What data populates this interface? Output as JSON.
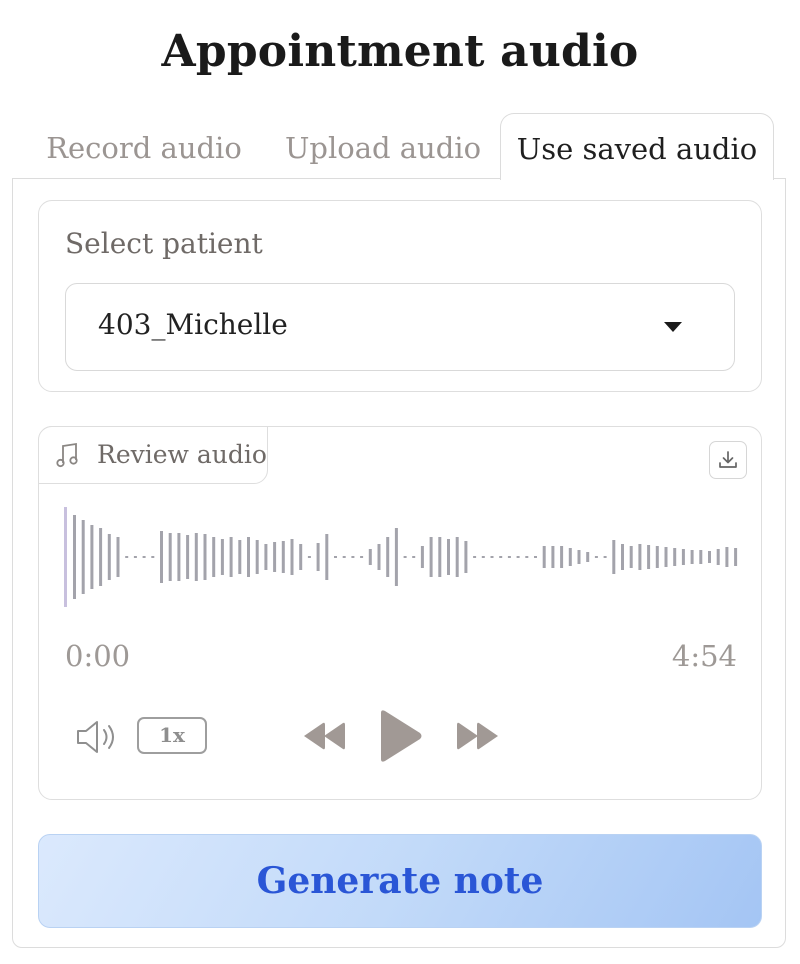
{
  "page": {
    "title": "Appointment audio"
  },
  "tabs": [
    {
      "label": "Record audio",
      "active": false
    },
    {
      "label": "Upload audio",
      "active": false
    },
    {
      "label": "Use saved audio",
      "active": true
    }
  ],
  "patient": {
    "label": "Select patient",
    "selected": "403_Michelle"
  },
  "audio": {
    "section_label": "Review audio",
    "current_time": "0:00",
    "duration": "4:54",
    "playback_rate": "1x",
    "playhead_color": "#c8c0de",
    "waveform_color": "#a3a3ab"
  },
  "actions": {
    "generate_label": "Generate note"
  },
  "colors": {
    "accent_text": "#2a56d6",
    "button_bg": "#c2daf9"
  }
}
